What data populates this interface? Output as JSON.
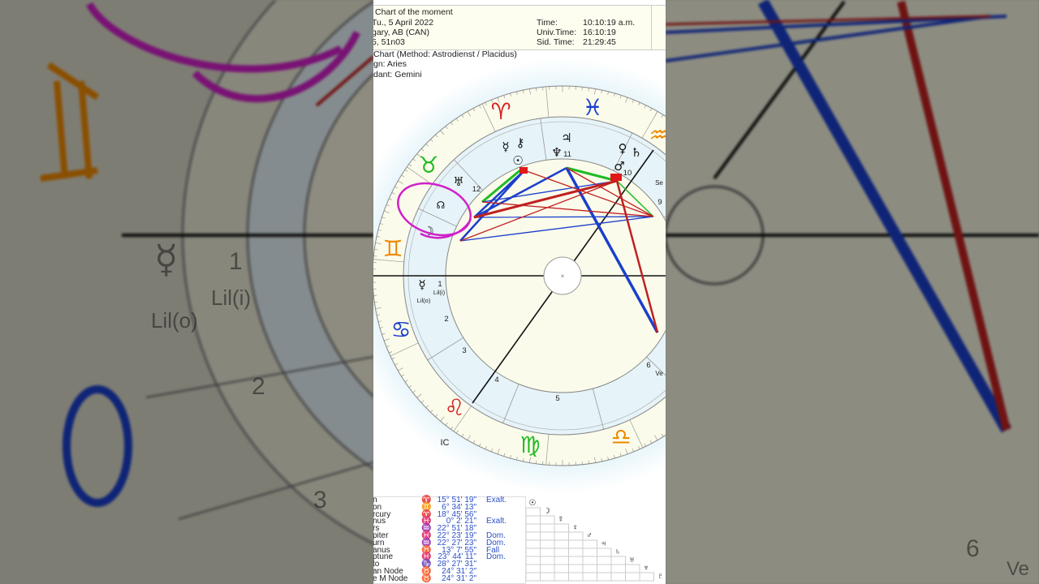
{
  "header": {
    "title": "Chart of the moment",
    "date": "Tu., 5 April 2022",
    "place": "gary, AB (CAN)",
    "coords": "5, 51n03",
    "time_label": "Time:",
    "time_value": "10:10:19 a.m.",
    "ut_label": "Univ.Time:",
    "ut_value": "16:10:19",
    "sid_label": "Sid. Time:",
    "sid_value": "21:29:45"
  },
  "info": {
    "method": "Chart  (Method: Astrodienst / Placidus)",
    "sign": "gn: Aries",
    "ascendant": "dant: Gemini"
  },
  "chart": {
    "houses": [
      "1",
      "2",
      "3",
      "4",
      "5",
      "6",
      "9",
      "10",
      "11",
      "12"
    ],
    "ic_label": "IC",
    "planets": {
      "sun": "☉",
      "moon": "☽",
      "mercury": "☿",
      "venus": "♀",
      "mars": "♂",
      "jupiter": "♃",
      "saturn": "♄",
      "uranus": "♅",
      "neptune": "♆",
      "chiron": "⚷",
      "node": "☊",
      "lilith": "⚸"
    },
    "lil_o": "Lil(o)",
    "lil_i": "Lil(i)",
    "side_labels": {
      "se": "Se",
      "ve": "Ve"
    },
    "signs": {
      "aries": "♈",
      "pisces": "♓",
      "taurus": "♉",
      "gemini": "♊",
      "cancer": "♋",
      "leo": "♌",
      "virgo": "♍",
      "libra": "♎",
      "aquarius": "♒"
    },
    "colors": {
      "fire": "#d42020",
      "earth": "#22bb22",
      "air": "#ee8800",
      "water": "#1a3fcc",
      "annotation": "#d020c8"
    }
  },
  "positions": [
    {
      "name": "n",
      "sign": "♈",
      "deg": "15° 51' 19\"",
      "dignity": "Exalt."
    },
    {
      "name": "on",
      "sign": "♊",
      "deg": "6° 34' 13\"",
      "dignity": ""
    },
    {
      "name": "rcury",
      "sign": "♈",
      "deg": "18° 45' 56\"",
      "dignity": ""
    },
    {
      "name": "nus",
      "sign": "♓",
      "deg": "0°  2' 21\"",
      "dignity": "Exalt."
    },
    {
      "name": "rs",
      "sign": "♒",
      "deg": "22° 51' 18\"",
      "dignity": ""
    },
    {
      "name": "piter",
      "sign": "♓",
      "deg": "22° 23' 19\"",
      "dignity": "Dom."
    },
    {
      "name": "urn",
      "sign": "♒",
      "deg": "22° 27' 23\"",
      "dignity": "Dom."
    },
    {
      "name": "anus",
      "sign": "♉",
      "deg": "13°  7' 55\"",
      "dignity": "Fall"
    },
    {
      "name": "ptune",
      "sign": "♓",
      "deg": "23° 44' 11\"",
      "dignity": "Dom."
    },
    {
      "name": "to",
      "sign": "♑",
      "deg": "28° 27' 31\"",
      "dignity": ""
    },
    {
      "name": "an Node",
      "sign": "♉",
      "deg": "24° 31'  2\"",
      "dignity": ""
    },
    {
      "name": "e M Node",
      "sign": "♉",
      "deg": "24° 31'  2\"",
      "dignity": ""
    }
  ],
  "aspect_grid": {
    "headers": [
      "☉",
      "☽",
      "☿",
      "♀",
      "♂",
      "♃",
      "♄",
      "♅",
      "♆",
      "♇"
    ]
  }
}
